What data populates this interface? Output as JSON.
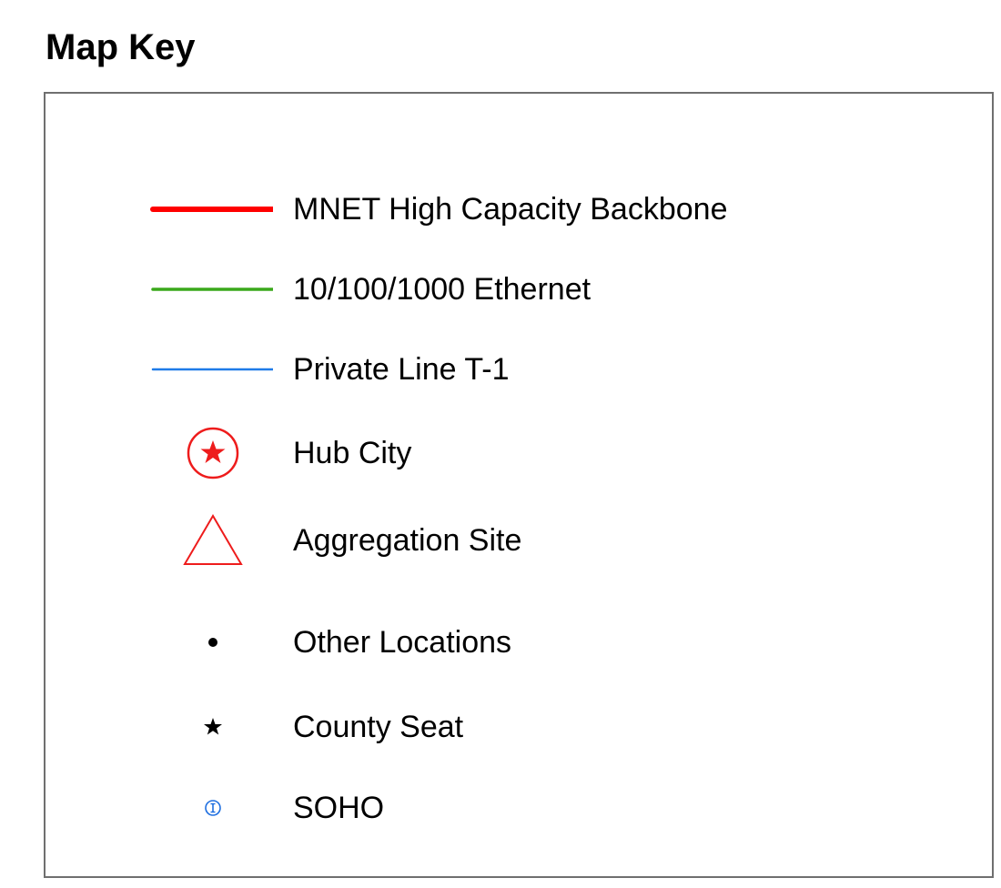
{
  "title": "Map Key",
  "colors": {
    "backbone": "#ff0000",
    "ethernet": "#3aa81b",
    "t1": "#1f7be8",
    "hub": "#ee1c1c",
    "aggregation": "#ee1c1c",
    "other": "#000000",
    "county_seat": "#000000",
    "soho": "#1f6fe0",
    "border": "#6f6f6f"
  },
  "legend": [
    {
      "label": "MNET High Capacity Backbone",
      "icon": "red-thick-line"
    },
    {
      "label": "10/100/1000 Ethernet",
      "icon": "green-line"
    },
    {
      "label": "Private Line T-1",
      "icon": "blue-line"
    },
    {
      "label": "Hub City",
      "icon": "circled-star"
    },
    {
      "label": "Aggregation Site",
      "icon": "triangle-outline"
    },
    {
      "label": "Other Locations",
      "icon": "dot"
    },
    {
      "label": "County Seat",
      "icon": "star"
    },
    {
      "label": "SOHO",
      "icon": "soho-circle-i"
    }
  ]
}
